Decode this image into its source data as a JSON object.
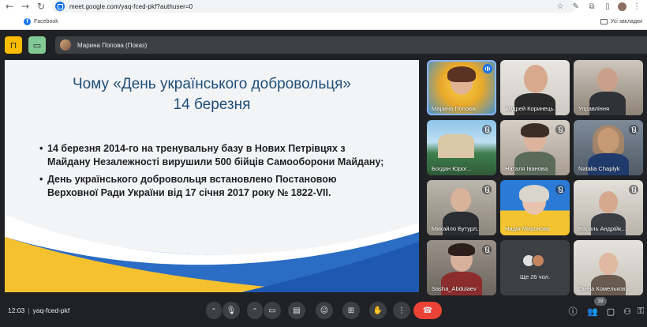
{
  "browser": {
    "url": "meet.google.com/yaq-fced-pkf?authuser=0",
    "bookmark": "Facebook",
    "all_bookmarks": "Усі закладки"
  },
  "meet": {
    "presenter_label": "Марина Попова (Показ)",
    "time": "12:03",
    "meeting_code": "yaq-fced-pkf",
    "participants_count": "39"
  },
  "slide": {
    "title_line1": "Чому «День українського добровольця»",
    "title_line2": "14 березня",
    "bullets": [
      "14 березня 2014-го на тренувальну базу в Нових Петрівцях з Майдану Незалежності вирушили 500 бійців Самооборони Майдану;",
      "День українського добровольця встановлено Постановою Верховної Ради України від 17 січня 2017 року № 1822-VII."
    ]
  },
  "tiles": [
    {
      "name": "Марина Попова"
    },
    {
      "name": "Андрей Коринець..."
    },
    {
      "name": "Управління"
    },
    {
      "name": "Богдан Юрог..."
    },
    {
      "name": "Наталя Іванова"
    },
    {
      "name": "Natalia Chaplyk"
    },
    {
      "name": "Михайло Бутурл..."
    },
    {
      "name": "Надія Миронова"
    },
    {
      "name": "Василь Андрійк..."
    },
    {
      "name": "Sasha_Abdulaev"
    },
    {
      "name": "Ще 26 чол."
    },
    {
      "name": "Ганна Комелькова"
    }
  ],
  "colors": {
    "meet_bg": "#202124",
    "tile_bg": "#3c4043",
    "end_call": "#ea4335",
    "slide_title": "#1f4e79",
    "slide_yellow": "#f6c12e",
    "slide_blue": "#2b6cc4"
  },
  "icons": {
    "controls": [
      "caret-up-icon",
      "mic-icon",
      "caret-up-icon",
      "camera-icon",
      "captions-icon",
      "emoji-icon",
      "present-icon",
      "raise-hand-icon",
      "more-vert-icon",
      "end-call-icon"
    ],
    "right": [
      "info-icon",
      "people-icon",
      "chat-icon",
      "activities-icon",
      "lock-icon"
    ]
  }
}
